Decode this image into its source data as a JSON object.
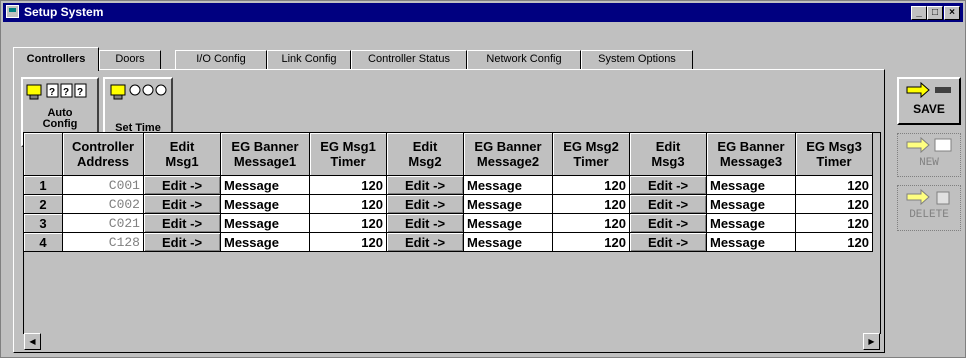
{
  "window": {
    "title": "Setup System"
  },
  "tabs": [
    {
      "label": "Controllers"
    },
    {
      "label": "Doors"
    },
    {
      "label": "I/O Config"
    },
    {
      "label": "Link Config"
    },
    {
      "label": "Controller Status"
    },
    {
      "label": "Network Config"
    },
    {
      "label": "System Options"
    }
  ],
  "toolbar": {
    "auto_config_line1": "Auto",
    "auto_config_line2": "Config",
    "set_time": "Set Time"
  },
  "side": {
    "save": "SAVE",
    "new": "NEW",
    "delete": "DELETE"
  },
  "columns": [
    {
      "l1": "",
      "l2": ""
    },
    {
      "l1": "Controller",
      "l2": "Address"
    },
    {
      "l1": "Edit",
      "l2": "Msg1"
    },
    {
      "l1": "EG Banner",
      "l2": "Message1"
    },
    {
      "l1": "EG Msg1",
      "l2": "Timer"
    },
    {
      "l1": "Edit",
      "l2": "Msg2"
    },
    {
      "l1": "EG Banner",
      "l2": "Message2"
    },
    {
      "l1": "EG Msg2",
      "l2": "Timer"
    },
    {
      "l1": "Edit",
      "l2": "Msg3"
    },
    {
      "l1": "EG Banner",
      "l2": "Message3"
    },
    {
      "l1": "EG Msg3",
      "l2": "Timer"
    }
  ],
  "rows": [
    {
      "num": "1",
      "addr": "C001",
      "e1": "Edit ->",
      "m1": "Message",
      "t1": "120",
      "e2": "Edit ->",
      "m2": "Message",
      "t2": "120",
      "e3": "Edit ->",
      "m3": "Message",
      "t3": "120"
    },
    {
      "num": "2",
      "addr": "C002",
      "e1": "Edit ->",
      "m1": "Message",
      "t1": "120",
      "e2": "Edit ->",
      "m2": "Message",
      "t2": "120",
      "e3": "Edit ->",
      "m3": "Message",
      "t3": "120"
    },
    {
      "num": "3",
      "addr": "C021",
      "e1": "Edit ->",
      "m1": "Message",
      "t1": "120",
      "e2": "Edit ->",
      "m2": "Message",
      "t2": "120",
      "e3": "Edit ->",
      "m3": "Message",
      "t3": "120"
    },
    {
      "num": "4",
      "addr": "C128",
      "e1": "Edit ->",
      "m1": "Message",
      "t1": "120",
      "e2": "Edit ->",
      "m2": "Message",
      "t2": "120",
      "e3": "Edit ->",
      "m3": "Message",
      "t3": "120"
    }
  ]
}
